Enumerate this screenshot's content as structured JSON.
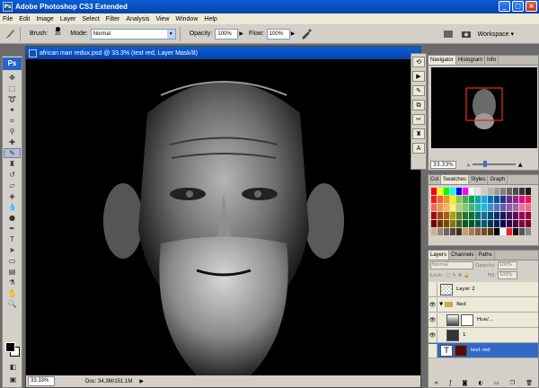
{
  "app": {
    "title": "Adobe Photoshop CS3 Extended",
    "ps_logo": "Ps",
    "window_buttons": [
      "_",
      "□",
      "×"
    ]
  },
  "menu": [
    "File",
    "Edit",
    "Image",
    "Layer",
    "Select",
    "Filter",
    "Analysis",
    "View",
    "Window",
    "Help"
  ],
  "options": {
    "brush_label": "Brush:",
    "brush_size": "35",
    "mode_label": "Mode:",
    "mode_value": "Normal",
    "opacity_label": "Opacity:",
    "opacity_value": "100%",
    "flow_label": "Flow:",
    "flow_value": "100%",
    "workspace_label": "Workspace ▾"
  },
  "document": {
    "title": "african man redux.psd @ 33.3% (text red, Layer Mask/8)",
    "zoom": "33.33%",
    "doc_info": "Doc: 34.3M/151.1M"
  },
  "navigator": {
    "tabs": [
      "Navigator",
      "Histogram",
      "Info"
    ],
    "zoom": "33.33%"
  },
  "swatches": {
    "tabs": [
      "Col",
      "Swatches",
      "Styles",
      "Graph"
    ],
    "colors": [
      "#ff0000",
      "#ffff00",
      "#00ff00",
      "#00ffff",
      "#0000ff",
      "#ff00ff",
      "#ffffff",
      "#e6e6e6",
      "#cccccc",
      "#b3b3b3",
      "#999999",
      "#808080",
      "#666666",
      "#4d4d4d",
      "#333333",
      "#1a1a1a",
      "#ed1c24",
      "#f26522",
      "#f7941d",
      "#fff200",
      "#8dc63f",
      "#39b54a",
      "#00a651",
      "#00a99d",
      "#00aeef",
      "#0072bc",
      "#0054a6",
      "#2e3192",
      "#662d91",
      "#92278f",
      "#ec008c",
      "#ed145b",
      "#f26c4f",
      "#f68e56",
      "#fbaf5d",
      "#fff568",
      "#acd373",
      "#7cc576",
      "#3cb878",
      "#1cbbb4",
      "#00bff3",
      "#448ccb",
      "#5574b9",
      "#605ca8",
      "#8560a8",
      "#a864a8",
      "#f06eaa",
      "#f26d7d",
      "#9e0b0f",
      "#a0410d",
      "#a36209",
      "#aba000",
      "#598527",
      "#197b30",
      "#007236",
      "#00746b",
      "#0076a3",
      "#004a80",
      "#003471",
      "#1b1464",
      "#440e62",
      "#630460",
      "#9e005d",
      "#9e0039",
      "#790000",
      "#7b2e00",
      "#7d4900",
      "#827b00",
      "#406618",
      "#005e20",
      "#005826",
      "#005952",
      "#005b7f",
      "#003663",
      "#002157",
      "#0d004c",
      "#32004b",
      "#4b0049",
      "#7b0046",
      "#7a0026",
      "#c7b299",
      "#998675",
      "#736357",
      "#534741",
      "#37302a",
      "#c69c6d",
      "#a67c52",
      "#8c6239",
      "#754c24",
      "#603913",
      "#000000",
      "#ffffff",
      "#ee1d24",
      "#111111",
      "#555555",
      "#888888"
    ]
  },
  "layers": {
    "tabs": [
      "Layers",
      "Channels",
      "Paths"
    ],
    "blend_mode": "Normal",
    "opacity_label": "Opacity:",
    "opacity_value": "100%",
    "lock_label": "Lock:",
    "fill_label": "Fill:",
    "fill_value": "100%",
    "rows": [
      {
        "name": "Layer 2",
        "visible": false,
        "type": "pixel"
      },
      {
        "name": "Red",
        "visible": true,
        "type": "group"
      },
      {
        "name": "Hue/...",
        "visible": true,
        "type": "adjustment"
      },
      {
        "name": "1",
        "visible": true,
        "type": "pixel"
      },
      {
        "name": "text red",
        "visible": false,
        "type": "text",
        "selected": true
      }
    ]
  }
}
